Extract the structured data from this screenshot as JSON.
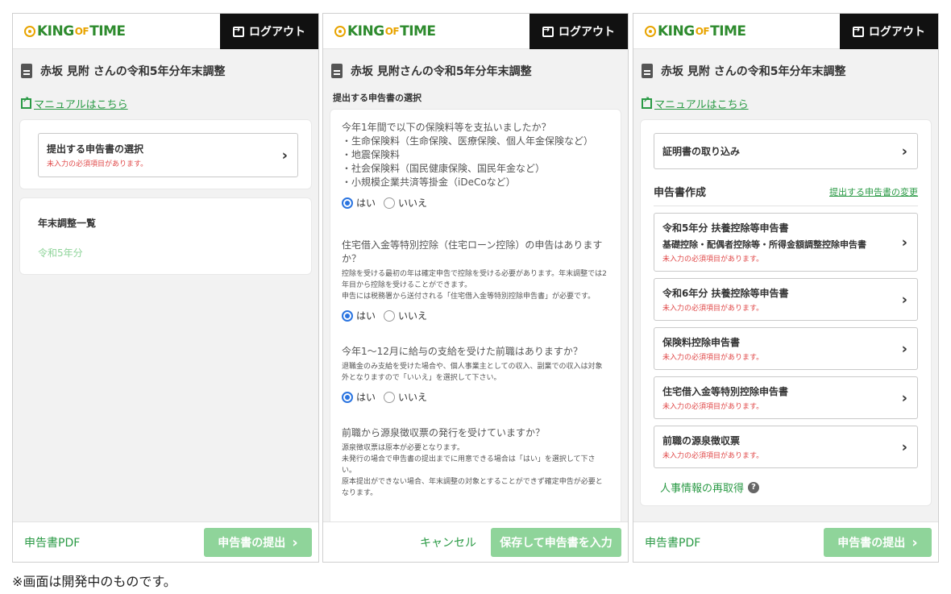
{
  "brand": {
    "king": "KING",
    "of": "OF",
    "time": "TIME"
  },
  "logout_label": "ログアウト",
  "screen1": {
    "title": "赤坂 見附 さんの令和5年分年末調整",
    "manual_link": "マニュアルはこちら",
    "select_item": {
      "label": "提出する申告書の選択",
      "error": "未入力の必須項目があります。"
    },
    "list_title": "年末調整一覧",
    "list_item": "令和5年分",
    "footer": {
      "pdf": "申告書PDF",
      "submit": "申告書の提出"
    }
  },
  "screen2": {
    "title": "赤坂 見附さんの令和5年分年末調整",
    "section_title": "提出する申告書の選択",
    "questions": [
      {
        "title": "今年1年間で以下の保険料等を支払いましたか？",
        "bullets": [
          "・生命保険料（生命保険、医療保険、個人年金保険など）",
          "・地震保険料",
          "・社会保険料（国民健康保険、国民年金など）",
          "・小規模企業共済等掛金（iDeCoなど）"
        ],
        "notes": [],
        "yes": "はい",
        "no": "いいえ",
        "selected": "yes"
      },
      {
        "title": "住宅借入金等特別控除（住宅ローン控除）の申告はありますか？",
        "bullets": [],
        "notes": [
          "控除を受ける最初の年は確定申告で控除を受ける必要があります。年末調整では2年目から控除を受けることができます。",
          "申告には税務署から送付される「住宅借入金等特別控除申告書」が必要です。"
        ],
        "yes": "はい",
        "no": "いいえ",
        "selected": "yes"
      },
      {
        "title": "今年1〜12月に給与の支給を受けた前職はありますか？",
        "bullets": [],
        "notes": [
          "退職金のみ支給を受けた場合や、個人事業主としての収入、副業での収入は対象外となりますので「いいえ」を選択して下さい。"
        ],
        "yes": "はい",
        "no": "いいえ",
        "selected": "yes"
      },
      {
        "title": "前職から源泉徴収票の発行を受けていますか？",
        "bullets": [],
        "notes": [
          "源泉徴収票は原本が必要となります。",
          "未発行の場合で申告書の提出までに用意できる場合は「はい」を選択して下さい。",
          "原本提出ができない場合、年末調整の対象とすることができず確定申告が必要となります。"
        ],
        "yes": "",
        "no": "",
        "selected": ""
      }
    ],
    "footer": {
      "cancel": "キャンセル",
      "save": "保存して申告書を入力"
    }
  },
  "screen3": {
    "title": "赤坂 見附 さんの令和5年分年末調整",
    "manual_link": "マニュアルはこちら",
    "import_item": "証明書の取り込み",
    "section_title": "申告書作成",
    "change_link": "提出する申告書の変更",
    "forms": [
      {
        "label": "令和5年分 扶養控除等申告書",
        "sub": "基礎控除・配偶者控除等・所得金額調整控除申告書",
        "error": "未入力の必須項目があります。"
      },
      {
        "label": "令和6年分 扶養控除等申告書",
        "sub": "",
        "error": "未入力の必須項目があります。"
      },
      {
        "label": "保険料控除申告書",
        "sub": "",
        "error": "未入力の必須項目があります。"
      },
      {
        "label": "住宅借入金等特別控除申告書",
        "sub": "",
        "error": "未入力の必須項目があります。"
      },
      {
        "label": "前職の源泉徴収票",
        "sub": "",
        "error": "未入力の必須項目があります。"
      }
    ],
    "reacquire": "人事情報の再取得",
    "footer": {
      "pdf": "申告書PDF",
      "submit": "申告書の提出"
    }
  },
  "caption": "※画面は開発中のものです。",
  "colors": {
    "accent_green": "#2a9a45",
    "button_green": "#8fd49a",
    "error_red": "#e04848",
    "radio_blue": "#2a74e0",
    "logout_bg": "#111111"
  }
}
